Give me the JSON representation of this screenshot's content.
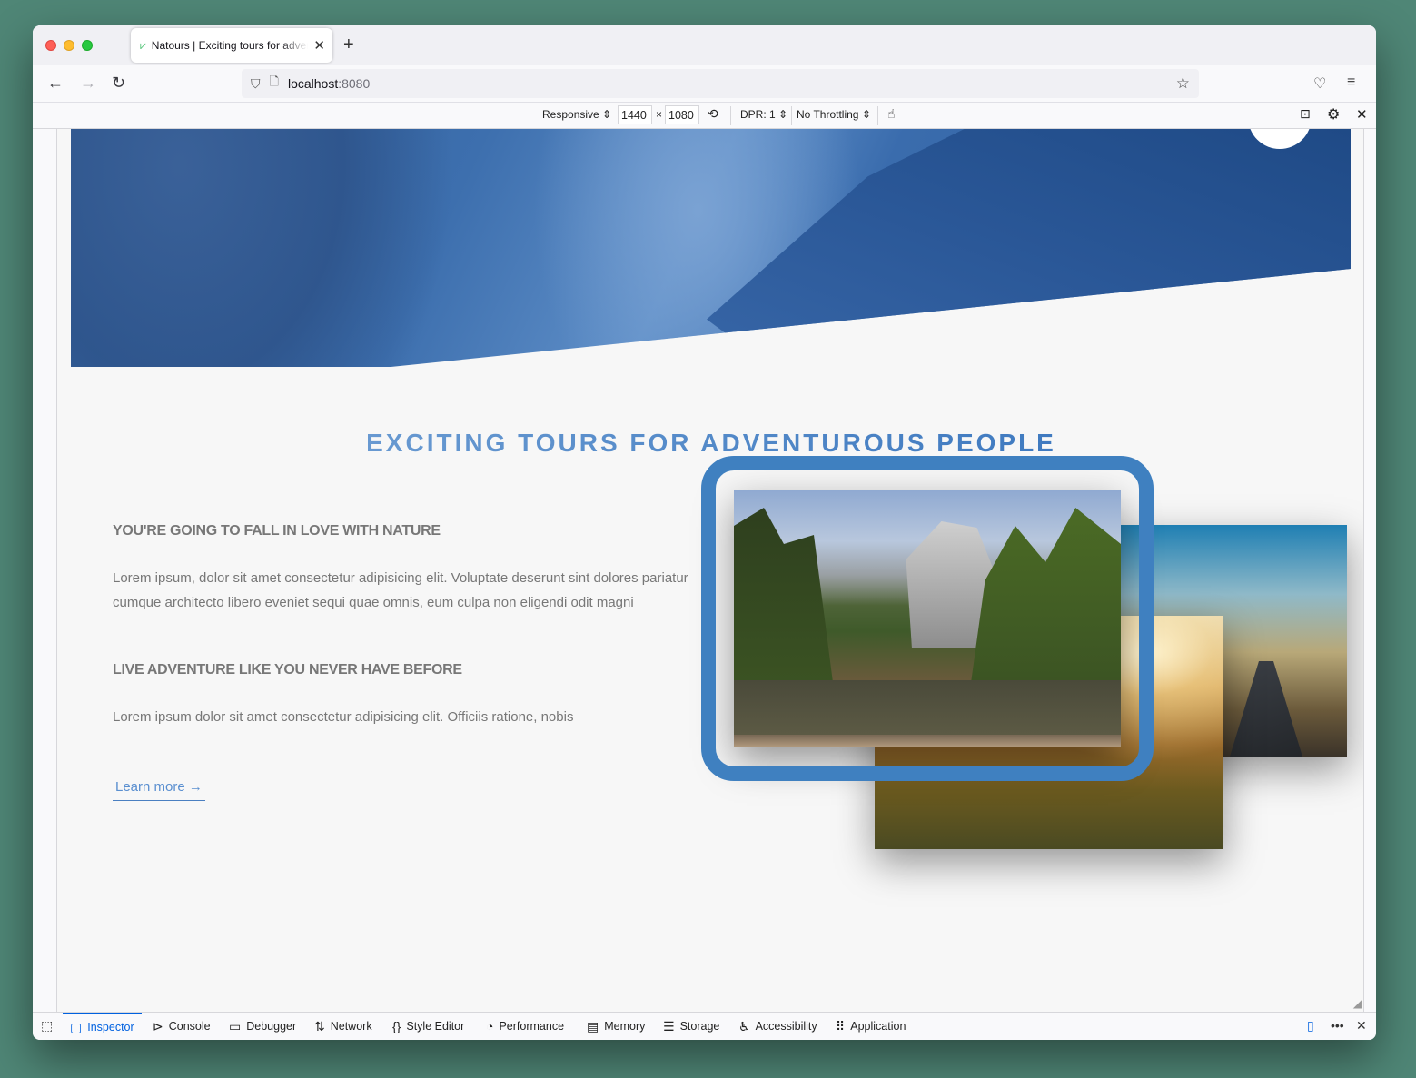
{
  "browser": {
    "tab_title": "Natours | Exciting tours for adventurous people",
    "url_host": "localhost",
    "url_port": ":8080"
  },
  "rdm": {
    "device": "Responsive",
    "width": "1440",
    "times": "×",
    "height": "1080",
    "dpr": "DPR: 1",
    "throttling": "No Throttling"
  },
  "page": {
    "heading": "EXCITING TOURS FOR ADVENTUROUS PEOPLE",
    "section1_title": "YOU'RE GOING TO FALL IN LOVE WITH NATURE",
    "section1_text": "Lorem ipsum, dolor sit amet consectetur adipisicing elit. Voluptate deserunt sint dolores pariatur cumque architecto libero eveniet sequi quae omnis, eum culpa non eligendi odit magni",
    "section2_title": "LIVE ADVENTURE LIKE YOU NEVER HAVE BEFORE",
    "section2_text": "Lorem ipsum dolor sit amet consectetur adipisicing elit. Officiis ratione, nobis",
    "learn_more": "Learn more →"
  },
  "devtools": {
    "tabs": [
      "Inspector",
      "Console",
      "Debugger",
      "Network",
      "Style Editor",
      "Performance",
      "Memory",
      "Storage",
      "Accessibility",
      "Application"
    ],
    "active_tab": "Inspector"
  },
  "colors": {
    "highlight": "#3f80c0",
    "heading_start": "#7aa7d9",
    "heading_end": "#2d6cb8",
    "devtools_active": "#0061e0"
  }
}
